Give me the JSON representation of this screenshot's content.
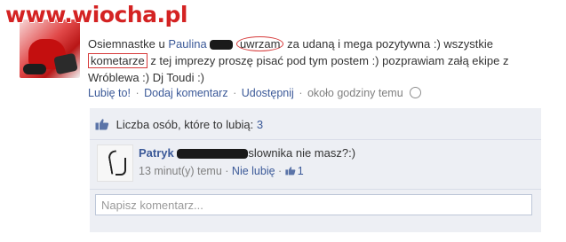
{
  "watermark": "www.wiocha.pl",
  "post": {
    "text_1": "Osiemnastke u ",
    "tagged_name": "Paulina",
    "text_2": " ",
    "circled_word": "uwrzam",
    "text_3": " za udaną i mega pozytywna :) wszystkie ",
    "boxed_word": "kometarze",
    "text_4": " z tej imprezy proszę pisać pod tym postem :) pozprawiam załą ekipe z Wróblewa :) Dj Toudi :)"
  },
  "actions": {
    "like": "Lubię to!",
    "comment": "Dodaj komentarz",
    "share": "Udostępnij",
    "time": "około godziny temu",
    "separator": "·"
  },
  "likes": {
    "label": "Liczba osób, które to lubią:",
    "count": "3"
  },
  "comment": {
    "author": "Patryk",
    "text": "slownika nie masz?:)",
    "time": "13 minut(y) temu",
    "unlike": "Nie lubię",
    "like_count": "1",
    "separator": "·"
  },
  "comment_input": {
    "placeholder": "Napisz komentarz..."
  },
  "colors": {
    "link": "#3b5998",
    "annotation": "#d63a3a",
    "comments_bg": "#edeff4"
  }
}
